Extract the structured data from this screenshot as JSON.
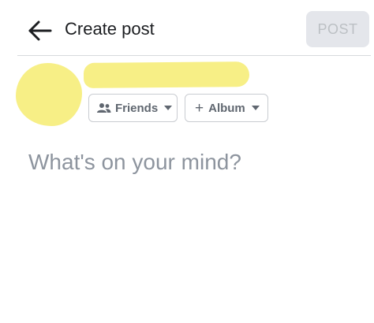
{
  "header": {
    "title": "Create post",
    "post_label": "POST",
    "back_icon": "arrow-left-icon"
  },
  "audience": {
    "friends_label": "Friends",
    "friends_icon": "people-icon",
    "album_prefix": "+",
    "album_label": "Album"
  },
  "composer": {
    "placeholder": "What's on your mind?",
    "value": ""
  },
  "colors": {
    "redaction": "#f7ef86",
    "post_button_bg": "#e4e6eb",
    "post_button_text": "#bcc0c4",
    "placeholder": "#8d949e"
  }
}
